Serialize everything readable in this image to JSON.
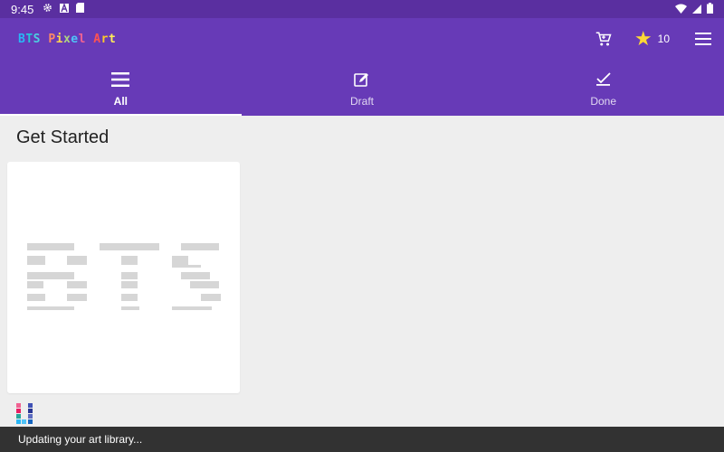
{
  "status_bar": {
    "time": "9:45"
  },
  "app": {
    "title_letters": [
      {
        "ch": "B",
        "color": "#29b6f6"
      },
      {
        "ch": "T",
        "color": "#26c6da"
      },
      {
        "ch": "S",
        "color": "#4dd0e1"
      },
      {
        "ch": " ",
        "color": "#ffffff"
      },
      {
        "ch": "P",
        "color": "#ff8a65"
      },
      {
        "ch": "i",
        "color": "#ffd54f"
      },
      {
        "ch": "x",
        "color": "#aed581"
      },
      {
        "ch": "e",
        "color": "#4fc3f7"
      },
      {
        "ch": "l",
        "color": "#f06292"
      },
      {
        "ch": " ",
        "color": "#ffffff"
      },
      {
        "ch": "A",
        "color": "#ff5252"
      },
      {
        "ch": "r",
        "color": "#ffca28"
      },
      {
        "ch": "t",
        "color": "#ffee58"
      }
    ],
    "coins": "10",
    "colors": {
      "primary": "#673ab7",
      "status_bar": "#5a2fa0",
      "star": "#fdd835",
      "background": "#eeeeee",
      "snackbar": "#323232"
    }
  },
  "tabs": [
    {
      "label": "All",
      "icon": "menu-lines-icon",
      "active": true
    },
    {
      "label": "Draft",
      "icon": "edit-icon",
      "active": false
    },
    {
      "label": "Done",
      "icon": "check-icon",
      "active": false
    }
  ],
  "main": {
    "section_title": "Get Started"
  },
  "snackbar": {
    "message": "Updating your art library..."
  }
}
